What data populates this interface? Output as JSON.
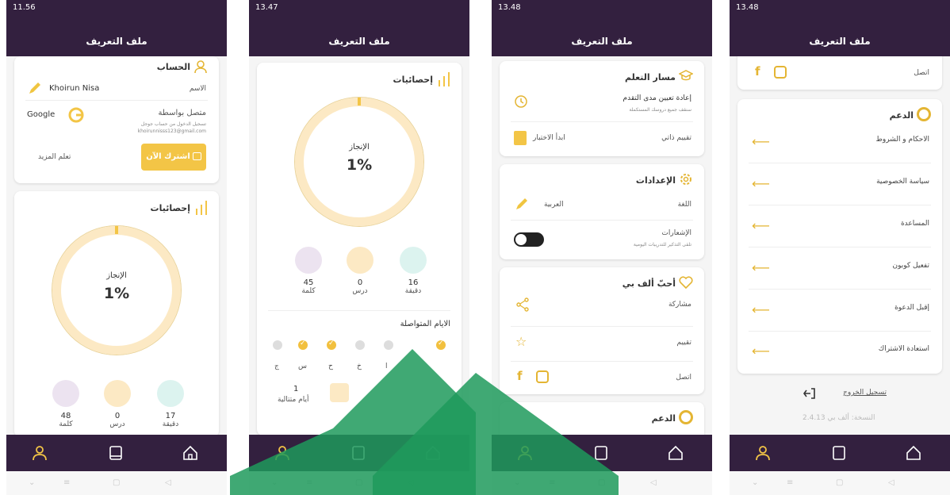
{
  "screen1": {
    "time": "11.56",
    "header": "ملف التعريف",
    "account_title": "الحساب",
    "name_label": "الاسم",
    "name_value": "Khoirun Nisa",
    "connected_label": "متصل بواسطة",
    "connected_sub": "تسجيل الدخول من حساب جوجل",
    "email": "khoirunnisss123@gmail.com",
    "provider": "Google",
    "subscribe_button": "اشترك الآن",
    "learn_more": "تعلم المزيد",
    "stats_title": "إحصائيات",
    "achievement_label": "الإنجاز",
    "achievement_value": "1%",
    "stats": [
      {
        "value": "48",
        "label": "كلمة"
      },
      {
        "value": "0",
        "label": "درس"
      },
      {
        "value": "17",
        "label": "دقيقة"
      }
    ]
  },
  "screen2": {
    "time": "13.47",
    "header": "ملف التعريف",
    "stats_title": "إحصائيات",
    "achievement_label": "الإنجاز",
    "achievement_value": "1%",
    "stats": [
      {
        "value": "45",
        "label": "كلمة"
      },
      {
        "value": "0",
        "label": "درس"
      },
      {
        "value": "16",
        "label": "دقيقة"
      }
    ],
    "streak_title": "الايام المتواصلة",
    "day_labels": [
      "ج",
      "س",
      "ح",
      "خ",
      "ا"
    ],
    "streak_value": "1",
    "streak_label": "أيام متتالية"
  },
  "screen3": {
    "time": "13.48",
    "header": "ملف التعريف",
    "learning_title": "مسار التعلم",
    "reset_title": "إعادة تعيين مدى التقدم",
    "reset_sub": "سنقف جميع دروسك المستكملة",
    "self_assess": "تقييم ذاتي",
    "start_test": "ابدأ الاختبار",
    "settings_title": "الإعدادات",
    "language_label": "اللغة",
    "language_value": "العربية",
    "notifications_label": "الإشعارات",
    "notifications_sub": "تلقى التذكير للتدريبات اليومية",
    "love_title": "أحبّ ألف بي",
    "share": "مشاركة",
    "rate": "تقييم",
    "contact": "اتصل",
    "support_title": "الدعم"
  },
  "screen4": {
    "time": "13.48",
    "header": "ملف التعريف",
    "contact": "اتصل",
    "support_title": "الدعم",
    "support_items": [
      "الاحكام و الشروط",
      "سياسة الخصوصية",
      "المساعدة",
      "تفعيل كوبون",
      "إقبل الدعوة",
      "استعادة الاشتراك"
    ],
    "logout": "تسجيل الخروج",
    "version": "النسخة: ألف بي 2.4.13"
  },
  "colors": {
    "header": "#33203f",
    "accent": "#f3c546",
    "ring": "#fce9c4"
  }
}
